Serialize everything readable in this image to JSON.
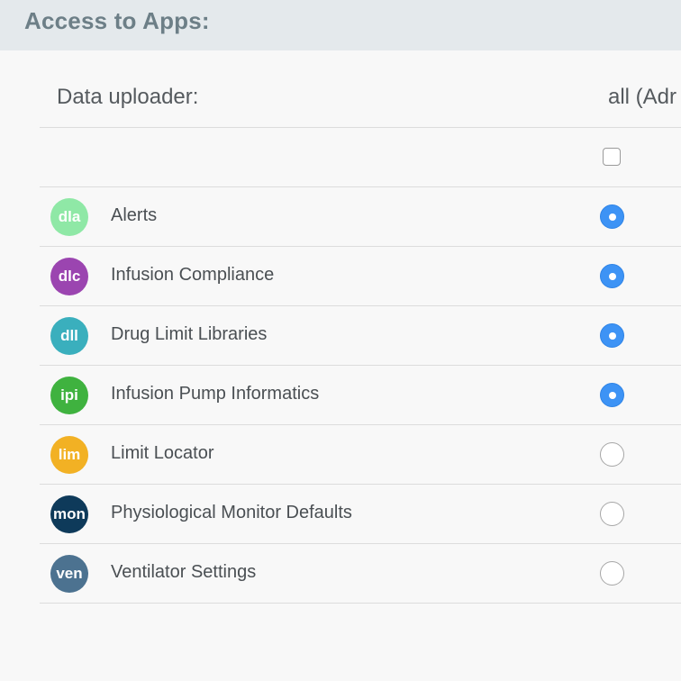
{
  "header": {
    "title": "Access to Apps:"
  },
  "table": {
    "role_label": "Data uploader:",
    "all_column_label": "all (Adr",
    "select_all_checked": false,
    "rows": [
      {
        "abbr": "dla",
        "name": "Alerts",
        "color": "#8fe8a6",
        "selected": true
      },
      {
        "abbr": "dlc",
        "name": "Infusion Compliance",
        "color": "#9b45b0",
        "selected": true
      },
      {
        "abbr": "dll",
        "name": "Drug Limit Libraries",
        "color": "#3aafbd",
        "selected": true
      },
      {
        "abbr": "ipi",
        "name": "Infusion Pump Informatics",
        "color": "#3fb23f",
        "selected": true
      },
      {
        "abbr": "lim",
        "name": "Limit Locator",
        "color": "#f2b124",
        "selected": false
      },
      {
        "abbr": "mon",
        "name": "Physiological Monitor Defaults",
        "color": "#0e3a5a",
        "selected": false
      },
      {
        "abbr": "ven",
        "name": "Ventilator Settings",
        "color": "#4c7290",
        "selected": false
      }
    ]
  }
}
